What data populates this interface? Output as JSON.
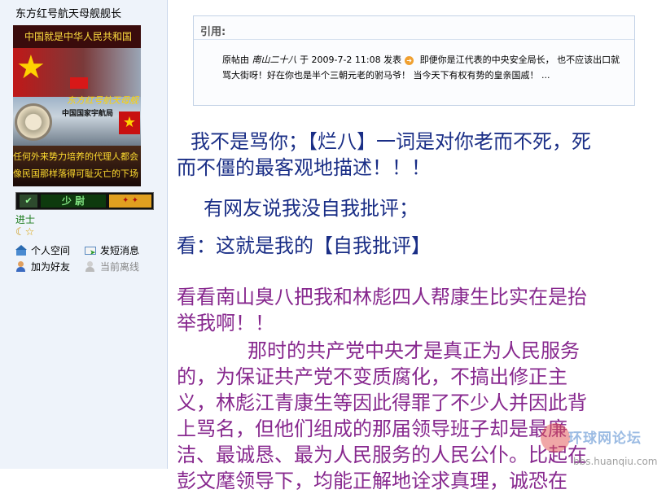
{
  "sidebar": {
    "username": "东方红号航天母舰舰长",
    "avatar": {
      "banner_top": "中国就是中华人民共和国",
      "ship_label": "东方红号航天母舰",
      "org_label": "中国国家宇航局",
      "banner_bottom_1": "任何外来势力培养的代理人都会",
      "banner_bottom_2": "像民国那样落得可耻灭亡的下场"
    },
    "rank_badge": "少 尉",
    "rank_title": "进士",
    "links": {
      "profile": "个人空间",
      "message": "发短消息",
      "add_friend": "加为好友",
      "status": "当前离线"
    }
  },
  "quote": {
    "title": "引用:",
    "prefix": "原帖由",
    "author": "南山二十八",
    "middle": "于  2009-7-2 11:08 发表",
    "text": "即便你是江代表的中央安全局长，  也不应该出口就骂大街呀！好在你也是半个三朝元老的驸马爷！   当今天下有权有势的皇亲国戚！  ..."
  },
  "content": {
    "p1_l1": "我不是骂你；【烂八】一词是对你老而不死，死",
    "p1_l2": "而不僵的最客观地描述！！！",
    "p2": "有网友说我没自我批评；",
    "p3": "看：这就是我的【自我批评】",
    "p4_l1": "看看南山臭八把我和林彪四人帮康生比实在是抬",
    "p4_l2": "举我啊！！",
    "p5_l1": "那时的共产党中央才是真正为人民服务",
    "p5_l2": "的，为保证共产党不变质腐化，不搞出修正主",
    "p5_l3": "义，林彪江青康生等因此得罪了不少人并因此背",
    "p5_l4": "上骂名，但他们组成的那届领导班子却是最廉",
    "p5_l5": "洁、最诚恳、最为人民服务的人民公仆。比起在",
    "p5_l6": "彭文麾领导下，均能正解地诠求真理，诚恐在"
  },
  "watermark": {
    "brand": "环球网论坛",
    "url": "bbs.huanqiu.com"
  }
}
